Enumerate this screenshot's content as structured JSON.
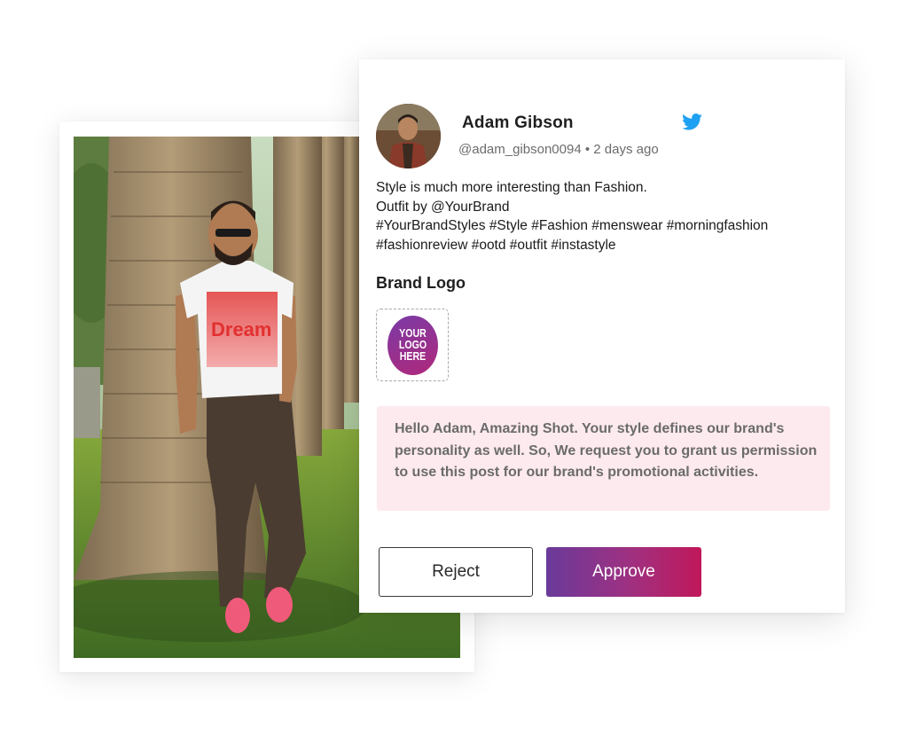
{
  "photo": {
    "shirt_text": "Dream"
  },
  "post": {
    "user_name": "Adam Gibson",
    "handle": "@adam_gibson0094",
    "separator": "•",
    "time_ago": "2 days ago",
    "platform_icon": "twitter-icon",
    "lines": [
      "Style is much more interesting than Fashion.",
      "Outfit by @YourBrand",
      "#YourBrandStyles #Style #Fashion #menswear #morningfashion",
      "#fashionreview #ootd #outfit #instastyle"
    ]
  },
  "brand": {
    "heading": "Brand Logo",
    "logo_line1": "YOUR",
    "logo_line2": "LOGO",
    "logo_line3": "HERE"
  },
  "message": {
    "text": "Hello Adam, Amazing Shot. Your style defines our brand's personality as well. So, We request you to grant us permission to use this post for our brand's promotional activities."
  },
  "actions": {
    "reject_label": "Reject",
    "approve_label": "Approve"
  },
  "colors": {
    "twitter_blue": "#1da1f2",
    "message_bg": "#fdeaee",
    "approve_start": "#6a3a9a",
    "approve_end": "#c0185a"
  }
}
